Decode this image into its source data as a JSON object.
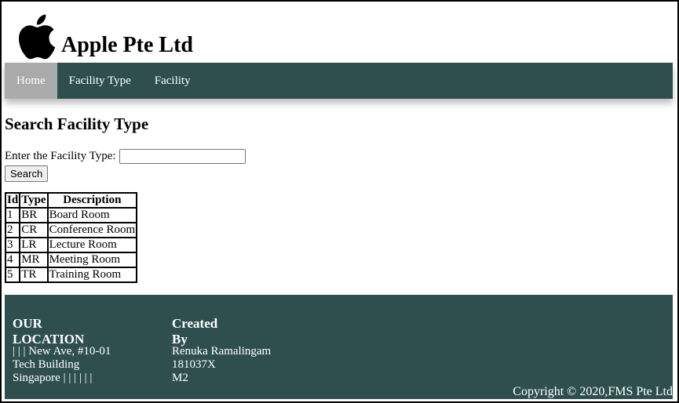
{
  "header": {
    "brand": "Apple Pte Ltd",
    "logo_icon": "apple-logo-icon"
  },
  "nav": {
    "items": [
      {
        "label": "Home",
        "active": true
      },
      {
        "label": "Facility Type",
        "active": false
      },
      {
        "label": "Facility",
        "active": false
      }
    ]
  },
  "main": {
    "title": "Search Facility Type",
    "search_label": "Enter the Facility Type:",
    "search_value": "",
    "search_button": "Search"
  },
  "table": {
    "headers": [
      "Id",
      "Type",
      "Description"
    ],
    "rows": [
      [
        "1",
        "BR",
        "Board Room"
      ],
      [
        "2",
        "CR",
        "Conference Room"
      ],
      [
        "3",
        "LR",
        "Lecture Room"
      ],
      [
        "4",
        "MR",
        "Meeting Room"
      ],
      [
        "5",
        "TR",
        "Training Room"
      ]
    ]
  },
  "footer": {
    "location_heading": "OUR LOCATION",
    "location_lines": [
      "| | | New Ave, #10-01",
      "Tech Building",
      "Singapore | | | | | |"
    ],
    "created_heading": "Created By",
    "created_lines": [
      "Renuka Ramalingam",
      "181037X",
      "M2"
    ],
    "copyright": "Copyright © 2020,FMS Pte Ltd"
  },
  "colors": {
    "nav_bg": "#2f4f4f",
    "nav_active": "#aaaaaa",
    "footer_bg": "#2f4f4f"
  }
}
